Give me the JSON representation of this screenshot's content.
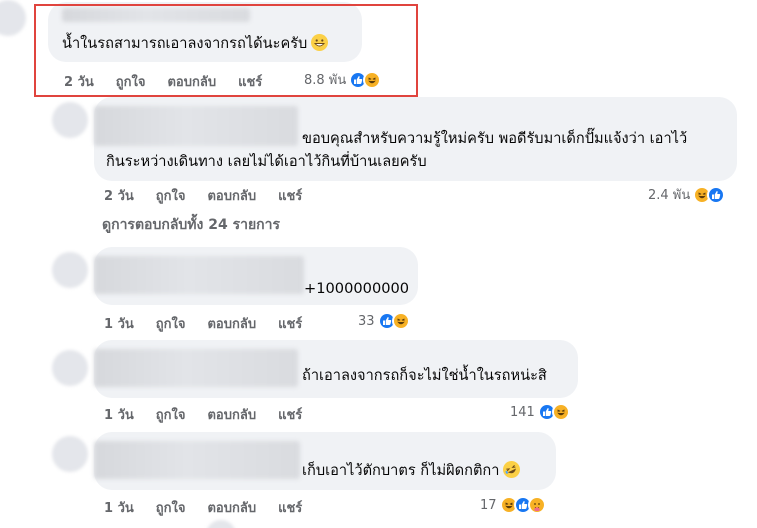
{
  "comments": [
    {
      "text": "น้ำในรถสามารถเอาลงจากรถได้นะครับ",
      "emoji": "grinning-emoji",
      "time": "2 วัน",
      "like": "ถูกใจ",
      "reply": "ตอบกลับ",
      "share": "แชร์",
      "reaction_count": "8.8 พัน",
      "reactions": [
        "like",
        "haha"
      ]
    },
    {
      "text_line1": "ขอบคุณสำหรับความรู้ใหม่ครับ พอดีรับมาเด็กปั๊มแจ้งว่า เอาไว้",
      "text_line2": "กินระหว่างเดินทาง เลยไม่ได้เอาไว้กินที่บ้านเลยครับ",
      "time": "2 วัน",
      "like": "ถูกใจ",
      "reply": "ตอบกลับ",
      "share": "แชร์",
      "reaction_count": "2.4 พัน",
      "reactions": [
        "haha",
        "like"
      ]
    },
    {
      "text": "+1000000000",
      "time": "1 วัน",
      "like": "ถูกใจ",
      "reply": "ตอบกลับ",
      "share": "แชร์",
      "reaction_count": "33",
      "reactions": [
        "like",
        "haha"
      ]
    },
    {
      "text": "ถ้าเอาลงจากรถก็จะไม่ใช่น้ำในรถหน่ะสิ",
      "time": "1 วัน",
      "like": "ถูกใจ",
      "reply": "ตอบกลับ",
      "share": "แชร์",
      "reaction_count": "141",
      "reactions": [
        "like",
        "haha"
      ]
    },
    {
      "text": "เก็บเอาไว้ตักบาตร ก็ไม่ผิดกติกา",
      "emoji": "rolling-laughing-emoji",
      "time": "1 วัน",
      "like": "ถูกใจ",
      "reply": "ตอบกลับ",
      "share": "แชร์",
      "reaction_count": "17",
      "reactions": [
        "haha",
        "like",
        "care"
      ]
    }
  ],
  "view_replies": "ดูการตอบกลับทั้ง 24 รายการ",
  "colors": {
    "highlight": "#e0443e",
    "like": "#1877f2",
    "haha": "#f7b125",
    "bubble": "#f0f2f5",
    "meta": "#65676b"
  }
}
